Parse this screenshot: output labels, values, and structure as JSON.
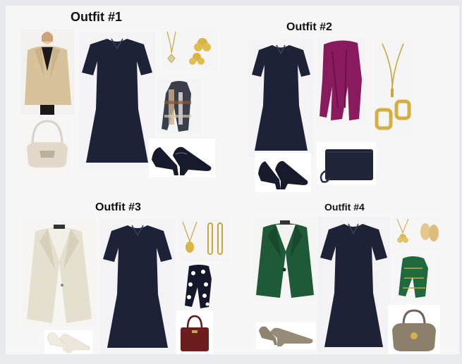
{
  "outfits": [
    {
      "title": "Outfit #1"
    },
    {
      "title": "Outfit #2"
    },
    {
      "title": "Outfit #3"
    },
    {
      "title": "Outfit #4"
    }
  ],
  "colors": {
    "dress": "#1d2236",
    "camel": "#d8c29c",
    "plum": "#8a1a5e",
    "navy": "#1f2438",
    "gold": "#c9a640",
    "tweed": "#e4dfcf",
    "green": "#1f5a38",
    "burgundy": "#6d1d1e",
    "taupe": "#8c7f6c",
    "patent": "#161a2a"
  }
}
